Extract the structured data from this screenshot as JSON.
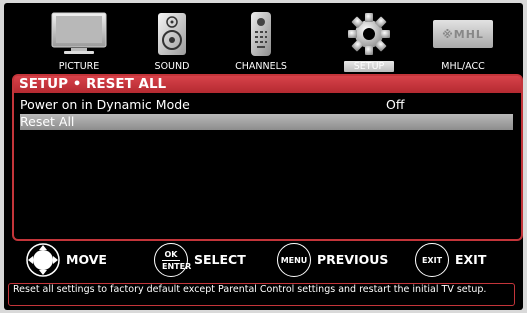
{
  "menu": {
    "items": [
      {
        "label": "PICTURE",
        "icon": "tv-icon"
      },
      {
        "label": "SOUND",
        "icon": "speaker-icon"
      },
      {
        "label": "CHANNELS",
        "icon": "remote-icon"
      },
      {
        "label": "SETUP",
        "icon": "gear-icon",
        "active": true
      },
      {
        "label": "MHL/ACC",
        "icon": "mhl-logo-icon",
        "logo_text": "MHL"
      }
    ]
  },
  "panel": {
    "title": "SETUP • RESET ALL",
    "rows": [
      {
        "label": "Power on in Dynamic Mode",
        "value": "Off",
        "selected": false
      },
      {
        "label": "Reset All",
        "value": "",
        "selected": true
      }
    ]
  },
  "guide": {
    "move": {
      "label": "MOVE"
    },
    "select": {
      "label": "SELECT",
      "key_top": "OK",
      "key_bottom": "ENTER"
    },
    "previous": {
      "label": "PREVIOUS",
      "key": "MENU"
    },
    "exit": {
      "label": "EXIT",
      "key": "EXIT"
    }
  },
  "help_text": "Reset all settings to factory default except Parental Control settings and restart the initial TV setup.",
  "colors": {
    "accent": "#c4353a",
    "selected_row": "#a8a8a8",
    "background": "#000000"
  }
}
